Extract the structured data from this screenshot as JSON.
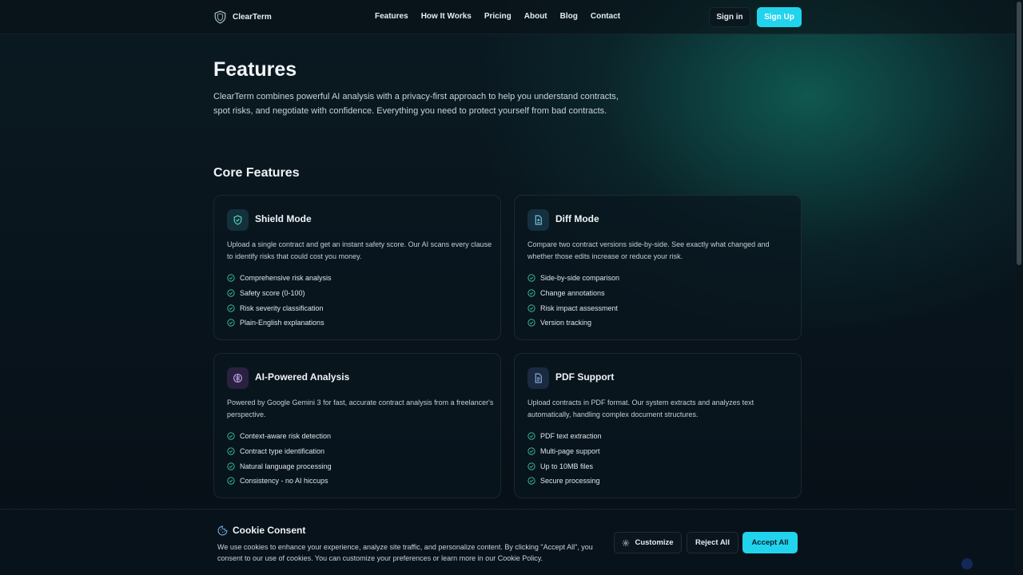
{
  "brand": {
    "name": "ClearTerm"
  },
  "nav": {
    "links": [
      "Features",
      "How It Works",
      "Pricing",
      "About",
      "Blog",
      "Contact"
    ],
    "signin": "Sign in",
    "signup": "Sign Up"
  },
  "hero": {
    "title": "Features",
    "description": "ClearTerm combines powerful AI analysis with a privacy-first approach to help you understand contracts, spot risks, and negotiate with confidence. Everything you need to protect yourself from bad contracts."
  },
  "section": {
    "title": "Core Features"
  },
  "cards": [
    {
      "icon": "shield-icon",
      "title": "Shield Mode",
      "description": "Upload a single contract and get an instant safety score. Our AI scans every clause to identify risks that could cost you money.",
      "features": [
        "Comprehensive risk analysis",
        "Safety score (0-100)",
        "Risk severity classification",
        "Plain-English explanations"
      ]
    },
    {
      "icon": "file-diff-icon",
      "title": "Diff Mode",
      "description": "Compare two contract versions side-by-side. See exactly what changed and whether those edits increase or reduce your risk.",
      "features": [
        "Side-by-side comparison",
        "Change annotations",
        "Risk impact assessment",
        "Version tracking"
      ]
    },
    {
      "icon": "brain-icon",
      "title": "AI-Powered Analysis",
      "description": "Powered by Google Gemini 3 for fast, accurate contract analysis from a freelancer's perspective.",
      "features": [
        "Context-aware risk detection",
        "Contract type identification",
        "Natural language processing",
        "Consistency - no AI hiccups"
      ]
    },
    {
      "icon": "file-text-icon",
      "title": "PDF Support",
      "description": "Upload contracts in PDF format. Our system extracts and analyzes text automatically, handling complex document structures.",
      "features": [
        "PDF text extraction",
        "Multi-page support",
        "Up to 10MB files",
        "Secure processing"
      ]
    }
  ],
  "cookie": {
    "title": "Cookie Consent",
    "text": "We use cookies to enhance your experience, analyze site traffic, and personalize content. By clicking \"Accept All\", you consent to our use of cookies. You can customize your preferences or learn more in our Cookie Policy.",
    "customize": "Customize",
    "reject": "Reject All",
    "accept": "Accept All"
  },
  "colors": {
    "accent": "#22d3ee",
    "background": "#08121a"
  }
}
